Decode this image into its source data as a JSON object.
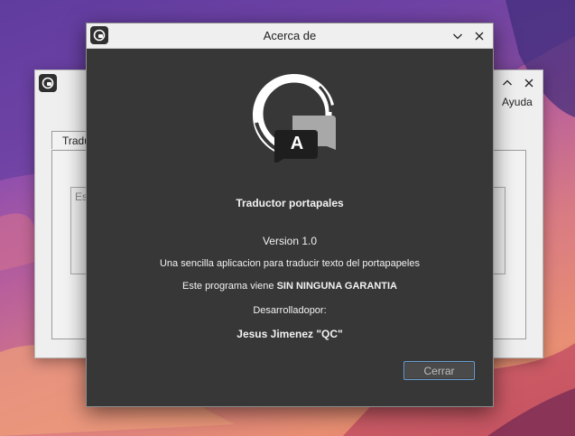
{
  "background_window": {
    "menu": {
      "help_label": "Ayuda"
    },
    "tab_label": "Tradu",
    "input_placeholder": "Es"
  },
  "dialog": {
    "title": "Acerca de",
    "logo": {
      "letter": "A"
    },
    "app_name": "Traductor portapales",
    "version": "Version 1.0",
    "description": "Una sencilla aplicacion para traducir texto del portapapeles",
    "warranty_prefix": "Este programa viene ",
    "warranty_bold": "SIN NINGUNA GARANTIA",
    "developer_label": "Desarrolladopor:",
    "developer_name": "Jesus Jimenez \"QC\"",
    "close_button": "Cerrar"
  },
  "colors": {
    "dialog_background": "#373737",
    "titlebar": "#efefef",
    "button_border_accent": "#6a9ed0"
  },
  "icons": [
    "app-logo-icon",
    "chevron-down-icon",
    "chevron-up-icon",
    "close-icon"
  ]
}
